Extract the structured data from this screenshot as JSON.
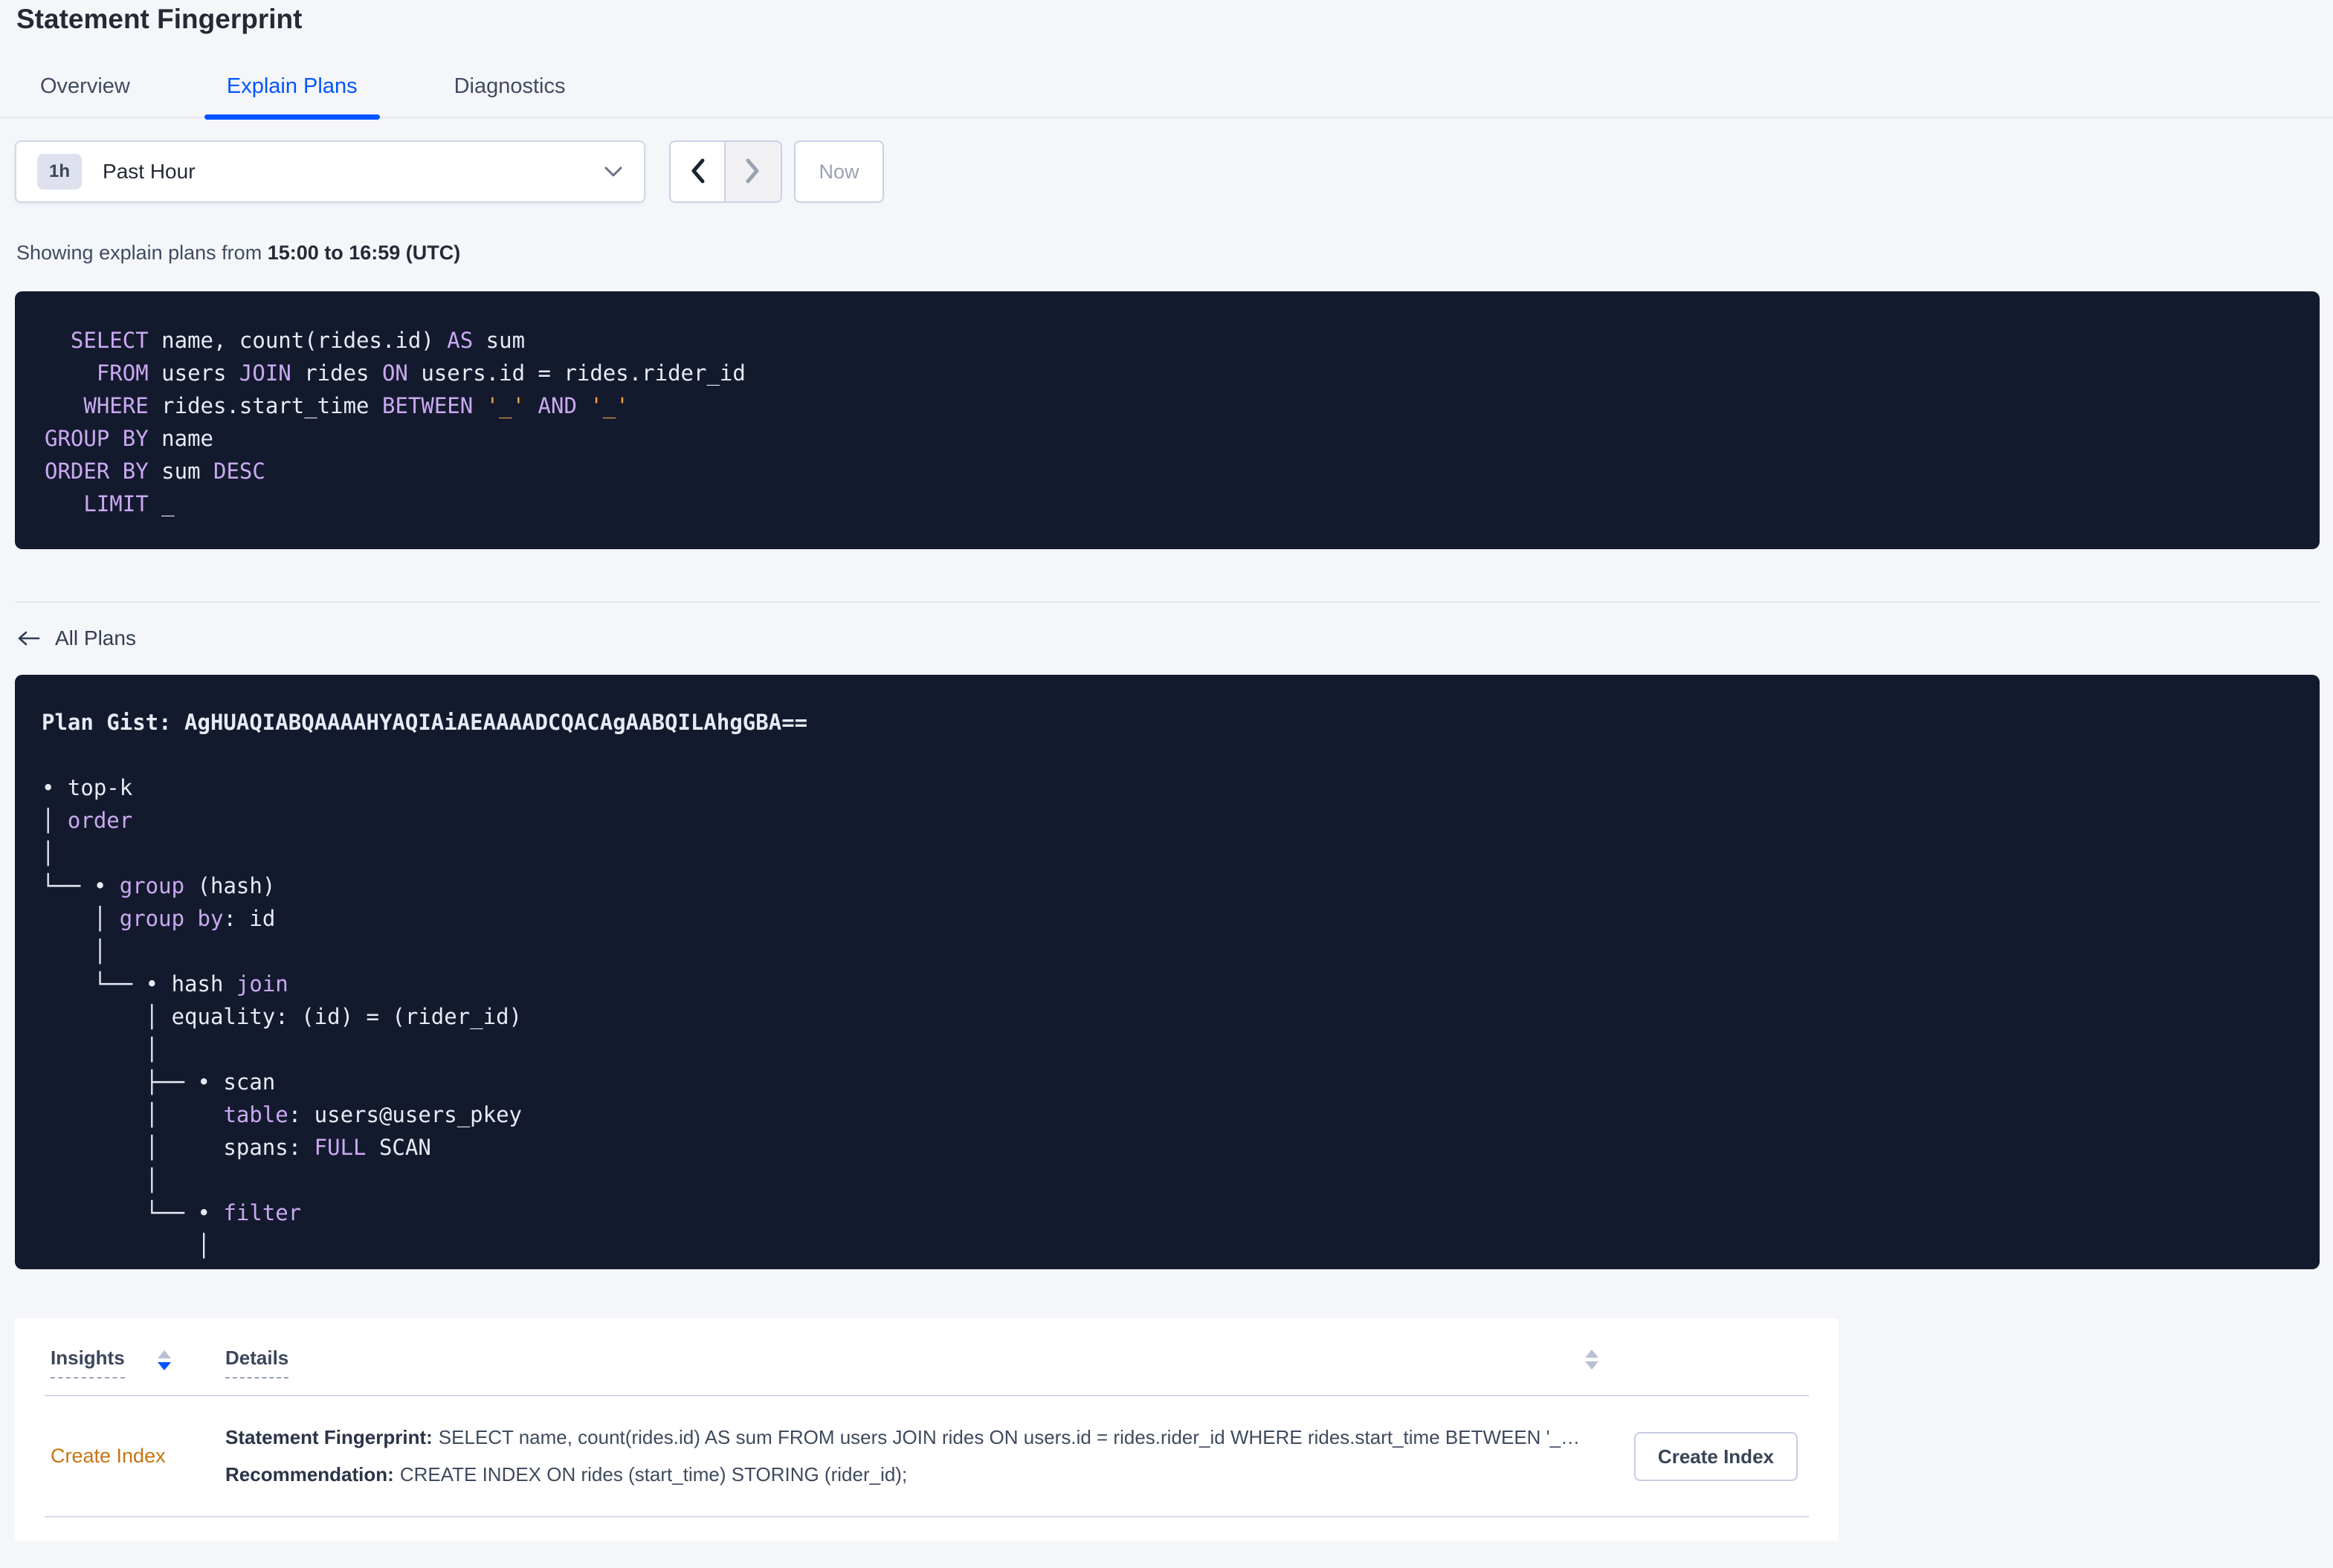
{
  "colors": {
    "accent_blue": "#0055ff",
    "code_bg": "#141a2e",
    "code_fg": "#e8eaf5",
    "code_keyword": "#c9a9f0",
    "code_orange": "#f2a04a",
    "insight_orange": "#c77413",
    "page_bg": "#f5f6fa"
  },
  "page": {
    "title": "Statement Fingerprint"
  },
  "tabs": [
    {
      "label": "Overview",
      "active": false
    },
    {
      "label": "Explain Plans",
      "active": true
    },
    {
      "label": "Diagnostics",
      "active": false
    }
  ],
  "time_picker": {
    "badge": "1h",
    "label": "Past Hour",
    "now_label": "Now"
  },
  "subtitle": {
    "prefix": "Showing explain plans from ",
    "range": "15:00 to 16:59 (UTC)"
  },
  "sql": {
    "lines": [
      [
        {
          "t": "  ",
          "c": "w"
        },
        {
          "t": "SELECT",
          "c": "k"
        },
        {
          "t": " name, count(rides.id) ",
          "c": "w"
        },
        {
          "t": "AS",
          "c": "k"
        },
        {
          "t": " sum",
          "c": "w"
        }
      ],
      [
        {
          "t": "    ",
          "c": "w"
        },
        {
          "t": "FROM",
          "c": "k"
        },
        {
          "t": " users ",
          "c": "w"
        },
        {
          "t": "JOIN",
          "c": "k"
        },
        {
          "t": " rides ",
          "c": "w"
        },
        {
          "t": "ON",
          "c": "k"
        },
        {
          "t": " users.id = rides.rider_id",
          "c": "w"
        }
      ],
      [
        {
          "t": "   ",
          "c": "w"
        },
        {
          "t": "WHERE",
          "c": "k"
        },
        {
          "t": " rides.start_time ",
          "c": "w"
        },
        {
          "t": "BETWEEN",
          "c": "k"
        },
        {
          "t": " ",
          "c": "w"
        },
        {
          "t": "'_'",
          "c": "o"
        },
        {
          "t": " ",
          "c": "w"
        },
        {
          "t": "AND",
          "c": "k"
        },
        {
          "t": " ",
          "c": "w"
        },
        {
          "t": "'_'",
          "c": "o"
        }
      ],
      [
        {
          "t": "GROUP BY",
          "c": "k"
        },
        {
          "t": " name",
          "c": "w"
        }
      ],
      [
        {
          "t": "ORDER BY",
          "c": "k"
        },
        {
          "t": " sum ",
          "c": "w"
        },
        {
          "t": "DESC",
          "c": "k"
        }
      ],
      [
        {
          "t": "   ",
          "c": "w"
        },
        {
          "t": "LIMIT",
          "c": "k"
        },
        {
          "t": " _",
          "c": "w"
        }
      ]
    ]
  },
  "all_plans_label": "All Plans",
  "plan": {
    "lines": [
      [
        {
          "t": "Plan Gist: AgHUAQIABQAAAAHYAQIAiAEAAAADCQACAgAABQILAhgGBA==",
          "c": "b"
        }
      ],
      [],
      [
        {
          "t": "• top-k",
          "c": "w"
        }
      ],
      [
        {
          "t": "│ ",
          "c": "w"
        },
        {
          "t": "order",
          "c": "k"
        }
      ],
      [
        {
          "t": "│",
          "c": "w"
        }
      ],
      [
        {
          "t": "└── • ",
          "c": "w"
        },
        {
          "t": "group",
          "c": "k"
        },
        {
          "t": " (hash)",
          "c": "w"
        }
      ],
      [
        {
          "t": "    │ ",
          "c": "w"
        },
        {
          "t": "group by",
          "c": "k"
        },
        {
          "t": ": id",
          "c": "w"
        }
      ],
      [
        {
          "t": "    │",
          "c": "w"
        }
      ],
      [
        {
          "t": "    └── • hash ",
          "c": "w"
        },
        {
          "t": "join",
          "c": "k"
        }
      ],
      [
        {
          "t": "        │ equality: (id) = (rider_id)",
          "c": "w"
        }
      ],
      [
        {
          "t": "        │",
          "c": "w"
        }
      ],
      [
        {
          "t": "        ├── • scan",
          "c": "w"
        }
      ],
      [
        {
          "t": "        │     ",
          "c": "w"
        },
        {
          "t": "table",
          "c": "k"
        },
        {
          "t": ": users@users_pkey",
          "c": "w"
        }
      ],
      [
        {
          "t": "        │     spans: ",
          "c": "w"
        },
        {
          "t": "FULL",
          "c": "k"
        },
        {
          "t": " SCAN",
          "c": "w"
        }
      ],
      [
        {
          "t": "        │",
          "c": "w"
        }
      ],
      [
        {
          "t": "        └── • ",
          "c": "w"
        },
        {
          "t": "filter",
          "c": "k"
        }
      ],
      [
        {
          "t": "            │",
          "c": "w"
        }
      ]
    ]
  },
  "insights_table": {
    "columns": {
      "insights": "Insights",
      "details": "Details"
    },
    "row": {
      "insight": "Create Index",
      "fingerprint_label": "Statement Fingerprint:",
      "fingerprint_text": "SELECT name, count(rides.id) AS sum FROM users JOIN rides ON users.id = rides.rider_id WHERE rides.start_time BETWEEN '_…",
      "recommendation_label": "Recommendation:",
      "recommendation_text": "CREATE INDEX ON rides (start_time) STORING (rider_id);",
      "action_label": "Create Index"
    }
  }
}
